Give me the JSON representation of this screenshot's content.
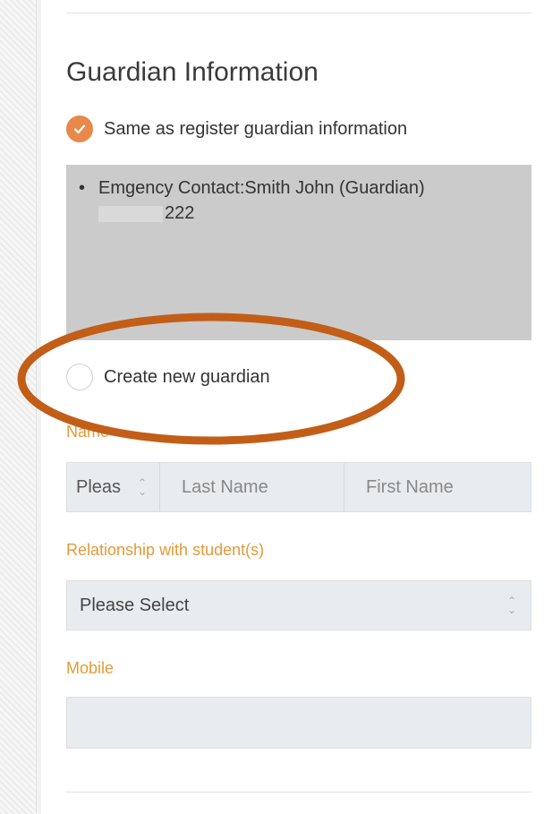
{
  "section": {
    "title": "Guardian Information"
  },
  "same_as_register": {
    "label": "Same as register guardian information",
    "checked": true
  },
  "emergency_contact": {
    "line": "Emgency Contact:Smith John (Guardian)",
    "phone_visible": "222"
  },
  "create_new": {
    "label": "Create new guardian",
    "checked": false
  },
  "name_field": {
    "label": "Name",
    "title_select_value": "Pleas",
    "last_name_placeholder": "Last Name",
    "first_name_placeholder": "First Name"
  },
  "relationship_field": {
    "label": "Relationship with student(s)",
    "select_value": "Please Select"
  },
  "mobile_field": {
    "label": "Mobile",
    "value": ""
  },
  "colors": {
    "accent": "#e8884a",
    "label": "#e49a3a",
    "annotation": "#c25e17",
    "info_box": "#cbcbcb",
    "input_bg": "#e9ecef"
  },
  "icons": {
    "checked_radio": "check-circle-icon",
    "select_arrow": "up-down-chevron-icon"
  }
}
